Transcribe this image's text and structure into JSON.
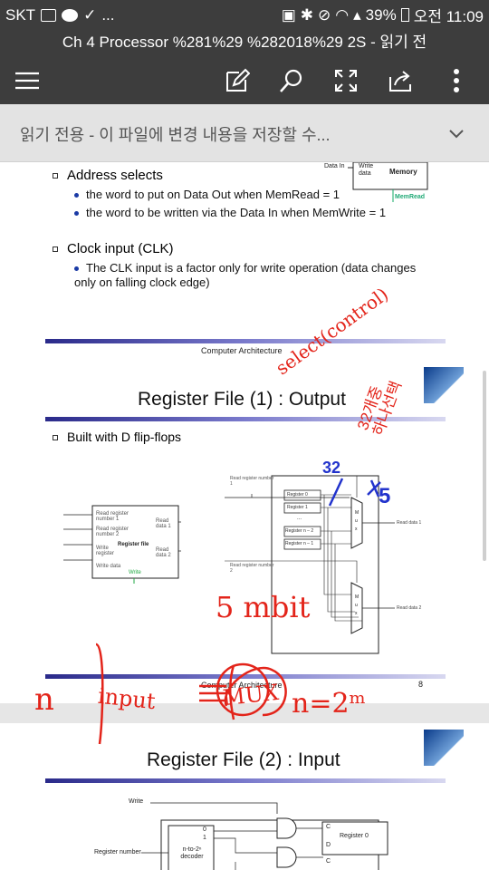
{
  "status": {
    "carrier": "SKT",
    "icons_left": [
      "image-icon",
      "talk-icon",
      "download-icon"
    ],
    "ellipsis": "...",
    "battery": "39%",
    "time": "오전 11:09"
  },
  "window": {
    "title": "Ch 4 Processor %281%29 %282018%29 2S - 읽기 전"
  },
  "notice": {
    "text": "읽기 전용 - 이 파일에 변경 내용을 저장할 수..."
  },
  "slide1": {
    "diagram": {
      "data_in": "Data In",
      "write_data": "Write data",
      "memory": "Memory",
      "memread": "MemRead"
    },
    "b1": "Address selects",
    "b1_sub": [
      "the word to put on Data Out when MemRead = 1",
      "the word to be written via the Data In when MemWrite = 1"
    ],
    "b2": "Clock input (CLK)",
    "b2_sub": [
      "The CLK input is a factor only for write operation (data changes only on falling clock edge)"
    ],
    "footer": "Computer Architecture"
  },
  "slide2": {
    "title": "Register File (1) : Output",
    "bullet": "Built with D flip-flops",
    "rf": {
      "rr1": "Read register number 1",
      "rr2": "Read register number 2",
      "wr": "Write register",
      "wd": "Write data",
      "rd1": "Read data 1",
      "rd2": "Read data 2",
      "name": "Register file",
      "write": "Write"
    },
    "mux": {
      "rrn1": "Read register number 1",
      "rrn2": "Read register number 2",
      "regs": [
        "Register 0",
        "Register 1",
        "Register n – 2",
        "Register n – 1"
      ],
      "rd1": "Read data 1",
      "rd2": "Read data 2",
      "m": "M",
      "u": "u",
      "x": "x",
      "dots": "..."
    },
    "footer": "Computer Architecture",
    "page": "8"
  },
  "slide3": {
    "title": "Register File (2) : Input",
    "write": "Write",
    "regnum": "Register number",
    "decoder": "n-to-2ⁿ decoder",
    "outs": [
      "0",
      "1"
    ],
    "reg0": "Register 0",
    "c": "C",
    "d": "D"
  },
  "annotations": {
    "select": "select(control)",
    "kor": "32개중 하나선택",
    "n32": "32",
    "n5": "5",
    "mbit": "5 mbit",
    "mux": "MUX",
    "n": "n",
    "input": "input",
    "eq": "n=2ᵐ"
  }
}
